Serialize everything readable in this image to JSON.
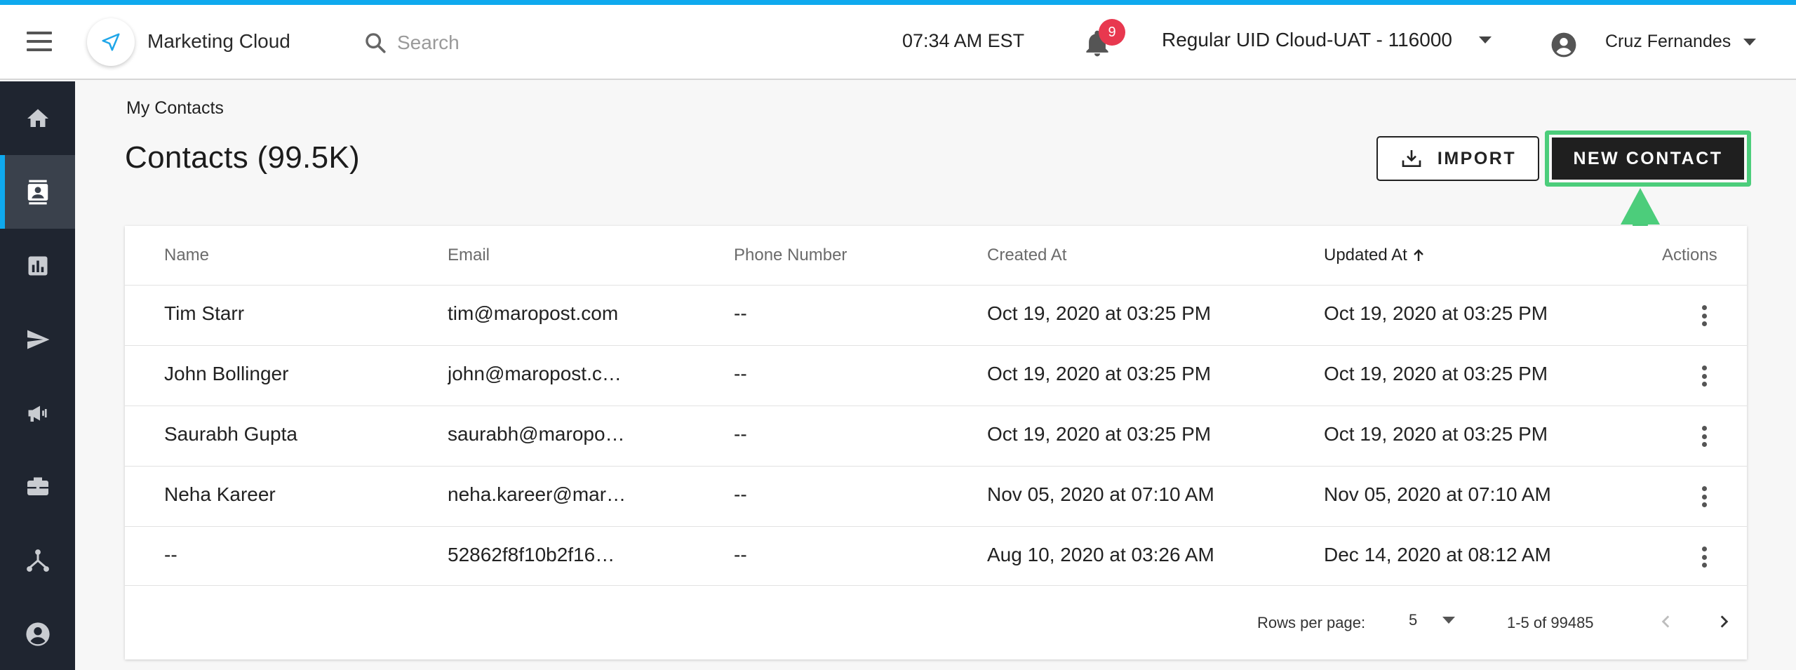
{
  "header": {
    "app_title": "Marketing Cloud",
    "search_placeholder": "Search",
    "time": "07:34 AM EST",
    "notification_count": "9",
    "account": "Regular UID Cloud-UAT - 116000",
    "user_name": "Cruz Fernandes"
  },
  "sidebar": {
    "items": [
      {
        "icon": "home-icon"
      },
      {
        "icon": "contacts-icon",
        "active": true
      },
      {
        "icon": "reports-icon"
      },
      {
        "icon": "send-icon"
      },
      {
        "icon": "megaphone-icon"
      },
      {
        "icon": "briefcase-icon"
      },
      {
        "icon": "workflow-icon"
      },
      {
        "icon": "account-icon"
      }
    ]
  },
  "page": {
    "breadcrumb": "My Contacts",
    "title": "Contacts (99.5K)",
    "import_label": "IMPORT",
    "new_contact_label": "NEW CONTACT"
  },
  "table": {
    "headers": {
      "name": "Name",
      "email": "Email",
      "phone": "Phone Number",
      "created": "Created At",
      "updated": "Updated At",
      "actions": "Actions"
    },
    "rows": [
      {
        "name": "Tim Starr",
        "email": "tim@maropost.com",
        "phone": "--",
        "created": "Oct 19, 2020 at 03:25 PM",
        "updated": "Oct 19, 2020 at 03:25 PM"
      },
      {
        "name": "John Bollinger",
        "email": "john@maropost.c…",
        "phone": "--",
        "created": "Oct 19, 2020 at 03:25 PM",
        "updated": "Oct 19, 2020 at 03:25 PM"
      },
      {
        "name": "Saurabh Gupta",
        "email": "saurabh@maropo…",
        "phone": "--",
        "created": "Oct 19, 2020 at 03:25 PM",
        "updated": "Oct 19, 2020 at 03:25 PM"
      },
      {
        "name": "Neha Kareer",
        "email": "neha.kareer@mar…",
        "phone": "--",
        "created": "Nov 05, 2020 at 07:10 AM",
        "updated": "Nov 05, 2020 at 07:10 AM"
      },
      {
        "name": "--",
        "email": "52862f8f10b2f16…",
        "phone": "--",
        "created": "Aug 10, 2020 at 03:26 AM",
        "updated": "Dec 14, 2020 at 08:12 AM"
      }
    ],
    "footer": {
      "rows_per_page_label": "Rows per page:",
      "rows_per_page_value": "5",
      "range": "1-5 of 99485"
    }
  },
  "colors": {
    "accent_blue": "#0fa9ee",
    "highlight_green": "#4ccd7b",
    "sidebar_bg": "#1f2530",
    "badge_red": "#e8384f"
  }
}
